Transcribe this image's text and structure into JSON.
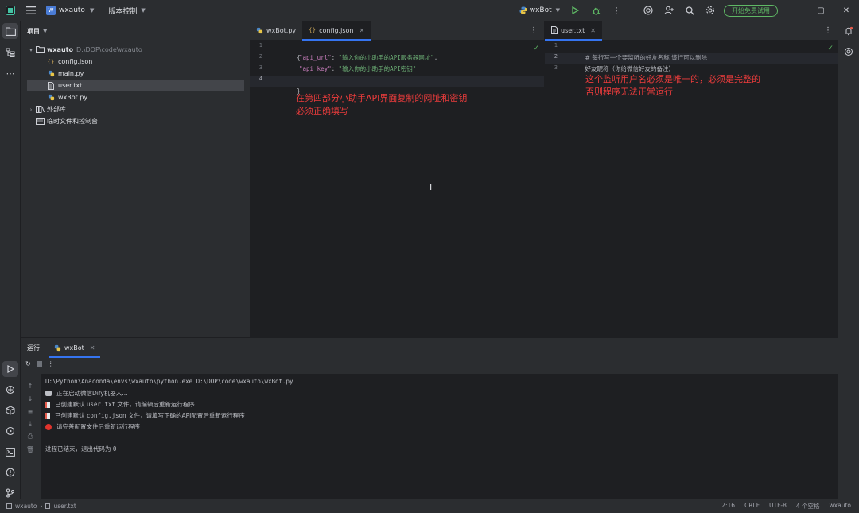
{
  "titlebar": {
    "project_badge": "W",
    "project_name": "wxauto",
    "vcs_label": "版本控制",
    "run_config": "wxBot",
    "trial_button": "开始免费试用",
    "minimize": "─",
    "maximize": "▢",
    "close": "✕"
  },
  "project_panel": {
    "title": "项目",
    "root_name": "wxauto",
    "root_path": "D:\\DOP\\code\\wxauto",
    "files": [
      "config.json",
      "main.py",
      "user.txt",
      "wxBot.py"
    ],
    "external_libs": "外部库",
    "scratches": "临时文件和控制台"
  },
  "editor_left": {
    "tabs": [
      {
        "label": "wxBot.py"
      },
      {
        "label": "config.json"
      }
    ],
    "more": "⋮",
    "line_numbers": [
      "1",
      "2",
      "3",
      "4"
    ],
    "code": {
      "l1": "{",
      "l2_key": "\"api_url\"",
      "l2_sep": ": ",
      "l2_val": "\"输入你的小助手的API服务器网址\"",
      "l2_end": ",",
      "l3_key": "\"api_key\"",
      "l3_sep": ": ",
      "l3_val": "\"输入你的小助手的API密钥\"",
      "l4": "}"
    },
    "annotation_line1": "在第四部分小助手API界面复制的网址和密钥",
    "annotation_line2": "必须正确填写"
  },
  "editor_right": {
    "tab_label": "user.txt",
    "more": "⋮",
    "line_numbers": [
      "1",
      "2",
      "3"
    ],
    "lines": [
      "# 每行写一个要监听的好友名称 该行可以删除",
      "好友昵称（你给微信好友的备注）"
    ],
    "annotation_line1": "这个监听用户名必须是唯一的，必须是完整的",
    "annotation_line2": "否则程序无法正常运行"
  },
  "run_panel": {
    "title": "运行",
    "tab_label": "wxBot",
    "console": {
      "cmd": "D:\\Python\\Anaconda\\envs\\wxauto\\python.exe D:\\DOP\\code\\wxauto\\wxBot.py",
      "line1": "正在启动微信Dify机器人...",
      "line2_a": "已创建默认 ",
      "line2_file": "user.txt",
      "line2_b": " 文件，请编辑后重新运行程序",
      "line3_a": "已创建默认 ",
      "line3_file": "config.json",
      "line3_b": " 文件，请填写正确的API配置后重新运行程序",
      "line4": "请完善配置文件后重新运行程序",
      "exit_a": "进程已结束，退出代码为 ",
      "exit_code": "0"
    }
  },
  "statusbar": {
    "project": "wxauto",
    "file": "user.txt",
    "position": "2:16",
    "line_sep": "CRLF",
    "encoding": "UTF-8",
    "indent": "4 个空格",
    "interpreter": "wxauto"
  },
  "colors": {
    "accent": "#3574f0",
    "annotation": "#ee3c3c",
    "trial_green": "#5fb865"
  }
}
